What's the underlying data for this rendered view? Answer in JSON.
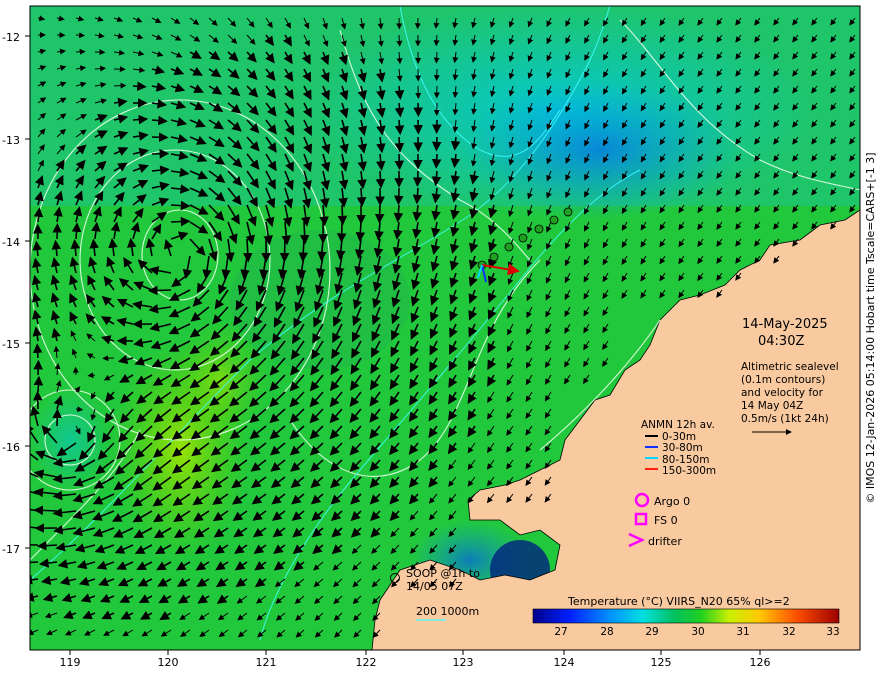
{
  "map": {
    "lat_ticks": [
      "-12",
      "-13",
      "-14",
      "-15",
      "-16",
      "-17"
    ],
    "lon_ticks": [
      "119",
      "120",
      "121",
      "122",
      "123",
      "124",
      "125",
      "126"
    ],
    "date": "14-May-2025",
    "time": "04:30Z",
    "altimetry_lines": [
      "Altimetric sealevel",
      "(0.1m contours)",
      "and velocity for",
      "14 May 04Z",
      "0.5m/s (1kt 24h)"
    ],
    "anmn_title": "ANMN 12h av.",
    "anmn_depths": [
      "0-30m",
      "30-80m",
      "80-150m",
      "150-300m"
    ],
    "anmn_colors": [
      "#000000",
      "#1030ff",
      "#00d8ff",
      "#ff2010"
    ],
    "argo_label": "Argo 0",
    "fs_label": "FS 0",
    "drifter_label": "drifter",
    "soop_lines": [
      "SOOP @1h to",
      "14/05 07Z"
    ],
    "isobath_label": "200  1000m",
    "colorbar_title": "Temperature (°C) VIIRS_N20 65% ql>=2",
    "colorbar_ticks": [
      "27",
      "28",
      "29",
      "30",
      "31",
      "32",
      "33"
    ],
    "credit": "© IMOS 12-Jan-2026 05:14:00 Hobart time Tscale=CARS+[-1 3]",
    "colors": {
      "land": "#f9caa0",
      "accent_magenta": "#ff00ff",
      "coast_isobath": "#40ffff"
    }
  }
}
